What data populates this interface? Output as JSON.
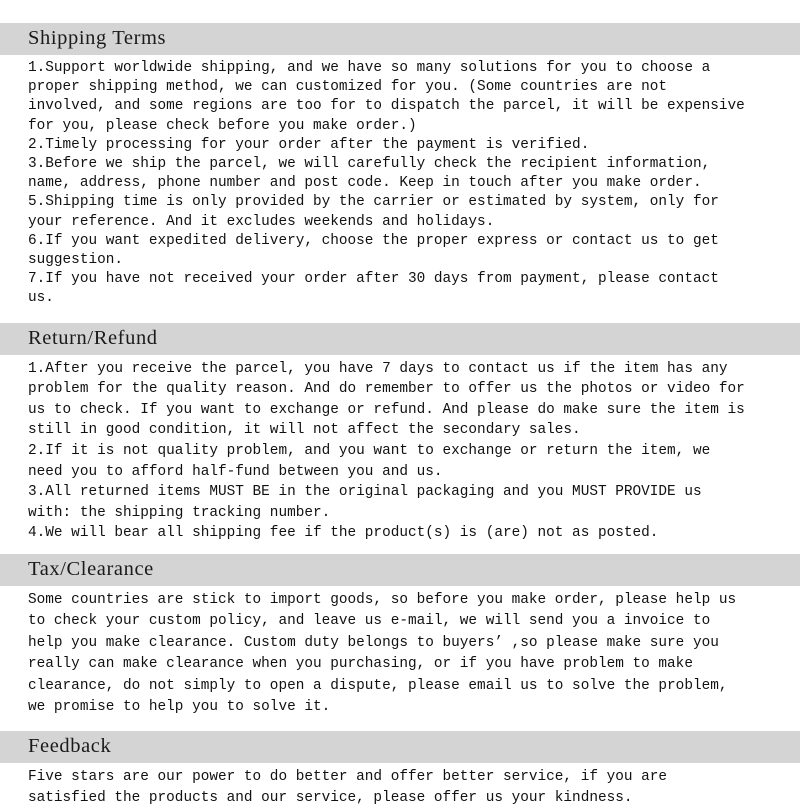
{
  "document": {
    "title": "Shipping Terms / Return-Refund / Tax-Clearance / Feedback policy page",
    "header_background": "#d4d4d4",
    "page_background": "#ffffff",
    "text_color": "#111111"
  },
  "sections": [
    {
      "id": "shipping-terms",
      "heading": "Shipping Terms",
      "lines": [
        "1.Support worldwide shipping, and we have so many solutions for you to choose a",
        "proper shipping method, we can customized for you. (Some countries are not",
        "involved, and some regions are too for to dispatch the parcel, it will be expensive",
        "for you, please check before you make order.)",
        "2.Timely processing for your order after the payment is verified.",
        "3.Before we ship the parcel, we will carefully check the recipient information,",
        "name, address, phone number and post code. Keep in touch after you make order.",
        "5.Shipping time is only provided by the carrier or estimated by system, only for",
        "your reference. And it excludes weekends and holidays.",
        "6.If you want expedited delivery, choose the proper express or contact us to get",
        "suggestion.",
        "7.If you have not received your order after 30 days from payment, please contact",
        "us."
      ]
    },
    {
      "id": "return-refund",
      "heading": "Return/Refund",
      "lines": [
        "1.After you receive the parcel, you have 7 days to contact us if the item has any",
        "problem for the quality reason. And do remember to offer us the photos or video for",
        "us to check. If you want to exchange or refund. And please do make sure the item is",
        "still in good condition, it will not affect the secondary sales.",
        "2.If it is not quality problem, and you want to exchange or return the item, we",
        "need you to afford half-fund between you and us.",
        "3.All returned items MUST BE in the original packaging and you MUST PROVIDE us",
        "with: the shipping tracking number.",
        "4.We will bear all shipping fee if the product(s) is (are) not as posted."
      ]
    },
    {
      "id": "tax-clearance",
      "heading": "Tax/Clearance",
      "lines": [
        "Some countries are stick to import goods, so before you make order, please help us",
        "to check your custom policy, and leave us e-mail, we will send you a invoice to",
        "help you make clearance. Custom duty belongs to buyers’ ,so please make sure you",
        "really can make clearance when you purchasing, or if you have problem to make",
        "clearance, do not simply to open a dispute, please email us to solve the problem,",
        "we promise to help you to solve it."
      ]
    },
    {
      "id": "feedback",
      "heading": "Feedback",
      "lines": [
        "Five stars are our power to do better and offer better service, if you are",
        "satisfied the products and our service, please offer us your kindness."
      ]
    }
  ]
}
